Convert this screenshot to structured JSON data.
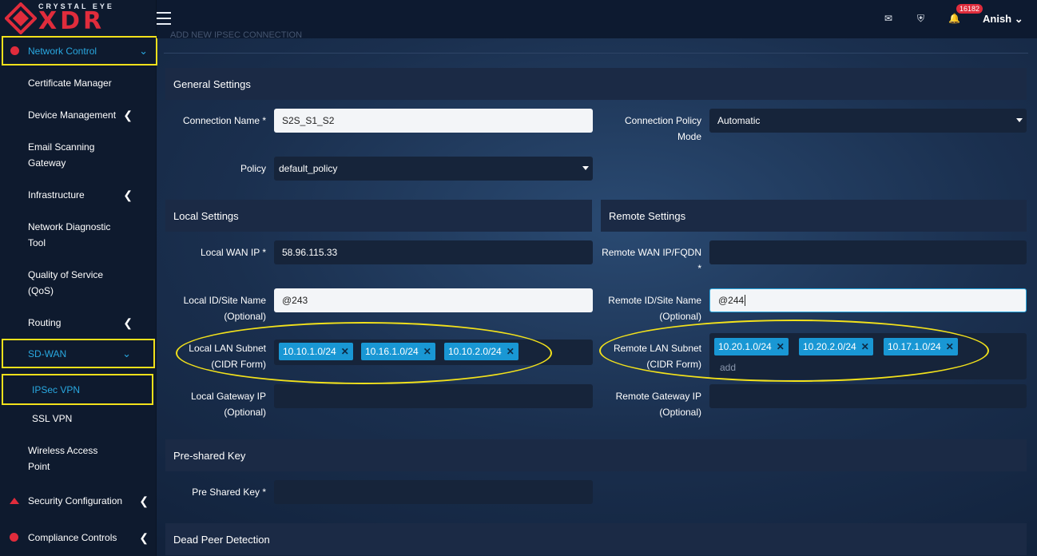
{
  "brand": {
    "small": "CRYSTAL EYE",
    "big": "XDR"
  },
  "sidebar": {
    "top_item": "Network Control",
    "items": [
      {
        "label": "Certificate Manager"
      },
      {
        "label": "Device Management"
      },
      {
        "label": "Email Scanning",
        "label2": "Gateway"
      },
      {
        "label": "Infrastructure"
      },
      {
        "label": "Network Diagnostic",
        "label2": "Tool"
      },
      {
        "label": "Quality of Service",
        "label2": "(QoS)"
      },
      {
        "label": "Routing"
      },
      {
        "label": "SD-WAN"
      },
      {
        "label": "IPSec VPN"
      },
      {
        "label": "SSL VPN"
      },
      {
        "label": "Wireless Access",
        "label2": "Point"
      },
      {
        "label": "Security Configuration"
      },
      {
        "label": "Compliance Controls"
      }
    ]
  },
  "topbar": {
    "notification_count": "16182",
    "user": "Anish",
    "page_subtitle": "ADD NEW IPSEC CONNECTION"
  },
  "general": {
    "title": "General Settings",
    "connection_name_label": "Connection Name *",
    "connection_name_value": "S2S_S1_S2",
    "connection_policy_mode_label1": "Connection Policy",
    "connection_policy_mode_label2": "Mode",
    "connection_policy_mode_value": "Automatic",
    "policy_label": "Policy",
    "policy_value": "default_policy"
  },
  "local": {
    "title": "Local Settings",
    "wan_ip_label": "Local WAN IP *",
    "wan_ip_value": "58.96.115.33",
    "id_label1": "Local ID/Site Name",
    "id_label2": "(Optional)",
    "id_value": "@243",
    "subnet_label1": "Local LAN Subnet",
    "subnet_label2": "(CIDR Form)",
    "subnets": [
      "10.10.1.0/24",
      "10.16.1.0/24",
      "10.10.2.0/24"
    ],
    "gateway_label1": "Local Gateway IP",
    "gateway_label2": "(Optional)"
  },
  "remote": {
    "title": "Remote Settings",
    "wan_ip_label1": "Remote WAN IP/FQDN",
    "wan_ip_label2": "*",
    "id_label1": "Remote ID/Site Name",
    "id_label2": "(Optional)",
    "id_value": "@244",
    "subnet_label1": "Remote LAN Subnet",
    "subnet_label2": "(CIDR Form)",
    "subnets": [
      "10.20.1.0/24",
      "10.20.2.0/24",
      "10.17.1.0/24"
    ],
    "subnet_placeholder": "add",
    "gateway_label1": "Remote Gateway IP",
    "gateway_label2": "(Optional)"
  },
  "psk": {
    "title": "Pre-shared Key",
    "label": "Pre Shared Key *"
  },
  "dpd": {
    "title": "Dead Peer Detection"
  },
  "colors": {
    "accent": "#29a8e0",
    "highlight": "#f2e11b",
    "brand_red": "#e02c3c",
    "tag": "#1997d4"
  }
}
